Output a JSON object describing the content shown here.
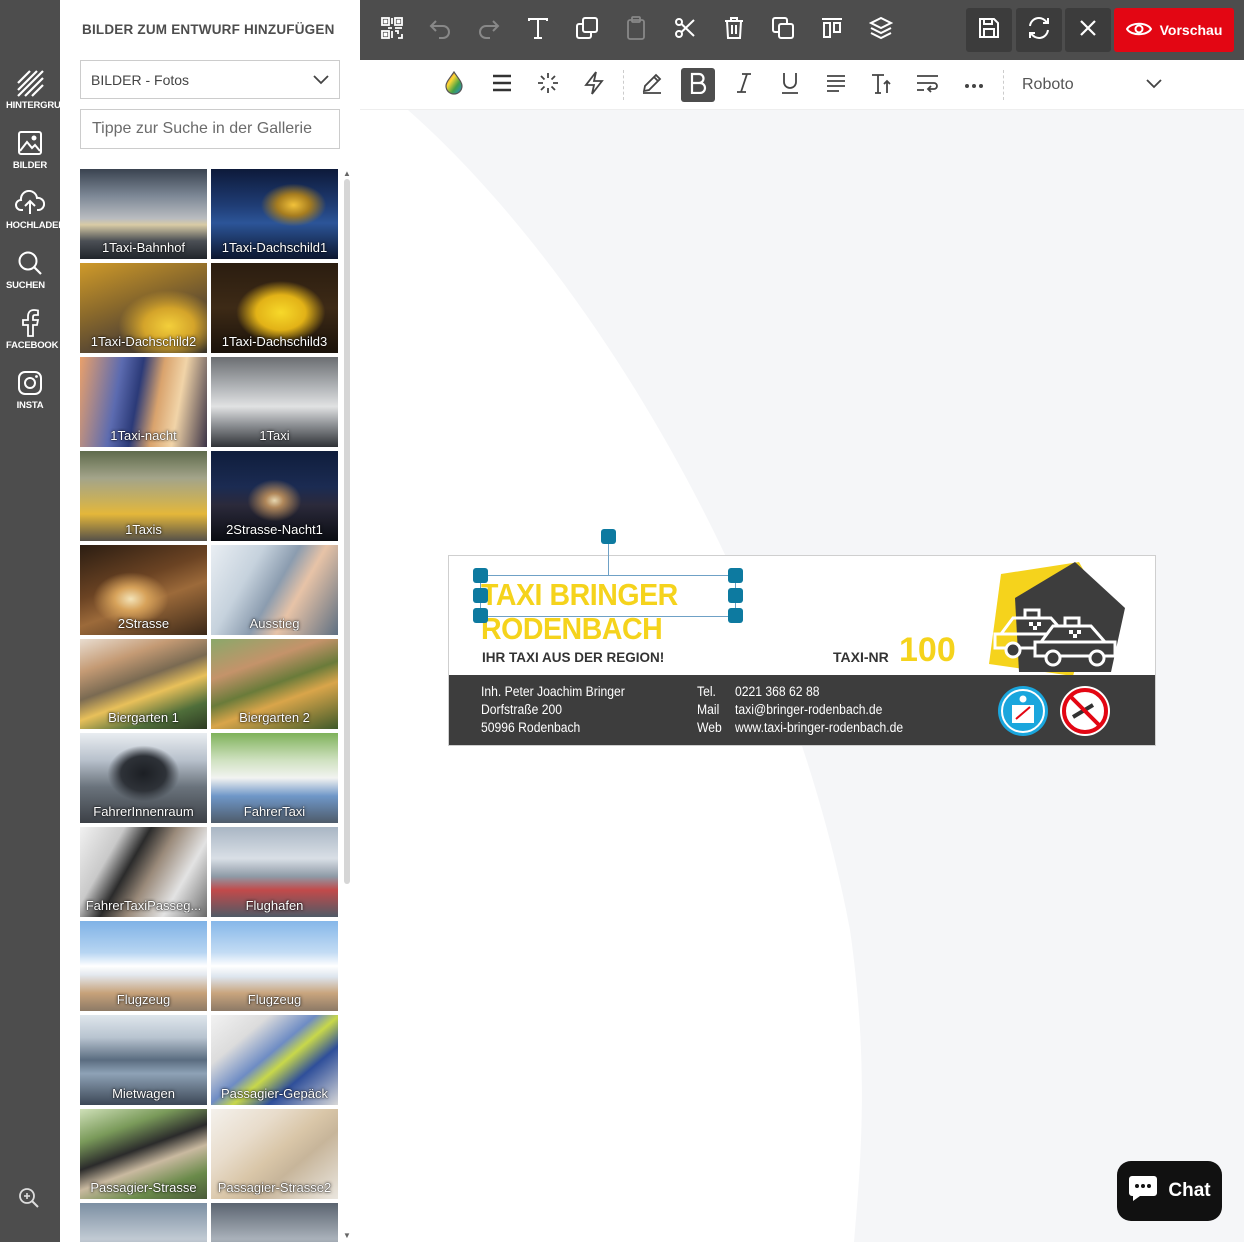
{
  "rail": {
    "items": [
      {
        "label": "HINTERGRUND",
        "icon": "background-icon"
      },
      {
        "label": "BILDER",
        "icon": "image-icon"
      },
      {
        "label": "HOCHLADEN",
        "icon": "upload-icon"
      },
      {
        "label": "SUCHEN",
        "icon": "search-icon"
      },
      {
        "label": "FACEBOOK",
        "icon": "facebook-icon"
      },
      {
        "label": "INSTA",
        "icon": "instagram-icon"
      }
    ],
    "zoom_icon": "zoom-in-icon"
  },
  "panel": {
    "title": "BILDER ZUM ENTWURF HINZUFÜGEN",
    "category_select": "BILDER - Fotos",
    "search_placeholder": "Tippe zur Suche in der Gallerie",
    "images": [
      "1Taxi-Bahnhof",
      "1Taxi-Dachschild1",
      "1Taxi-Dachschild2",
      "1Taxi-Dachschild3",
      "1Taxi-nacht",
      "1Taxi",
      "1Taxis",
      "2Strasse-Nacht1",
      "2Strasse",
      "Ausstieg",
      "Biergarten 1",
      "Biergarten 2",
      "FahrerInnenraum",
      "FahrerTaxi",
      "FahrerTaxiPasseg...",
      "Flughafen",
      "Flugzeug",
      "Flugzeug",
      "Mietwagen",
      "Passagier-Gepäck",
      "Passagier-Strasse",
      "Passagier-Strasse2",
      "",
      ""
    ]
  },
  "toolbar": {
    "preview_label": "Vorschau"
  },
  "formatbar": {
    "font": "Roboto"
  },
  "card": {
    "title_line1": "TAXI BRINGER",
    "title_line2": "RODENBACH",
    "tagline": "IHR TAXI AUS DER REGION!",
    "taxi_nr_label": "TAXI-NR",
    "taxi_nr_value": "100",
    "owner": "Inh. Peter Joachim Bringer",
    "street": "Dorfstraße 200",
    "city": "50996 Rodenbach",
    "tel_label": "Tel.",
    "tel_value": "0221 368 62 88",
    "mail_label": "Mail",
    "mail_value": "taxi@bringer-rodenbach.de",
    "web_label": "Web",
    "web_value": "www.taxi-bringer-rodenbach.de",
    "colors": {
      "accent": "#f5d31c",
      "dark": "#3d3d3d"
    }
  },
  "chat": {
    "label": "Chat"
  },
  "colors": {
    "rail": "#4d4d4d",
    "preview": "#e30613",
    "handle": "#0d7aa0"
  }
}
